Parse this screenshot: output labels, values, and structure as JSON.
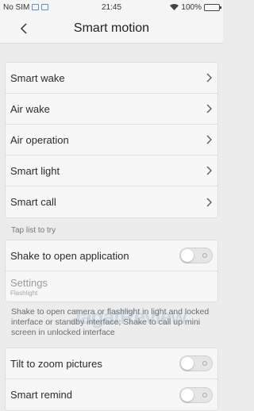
{
  "status": {
    "carrier": "No SIM",
    "time": "21:45",
    "battery": "100%",
    "battery_level": 1.0,
    "battery_color": "#3cb043"
  },
  "header": {
    "back_icon": "chevron-left-icon",
    "title": "Smart motion"
  },
  "main_menu": [
    {
      "label": "Smart wake"
    },
    {
      "label": "Air wake"
    },
    {
      "label": "Air operation"
    },
    {
      "label": "Smart light"
    },
    {
      "label": "Smart call"
    }
  ],
  "hint": "Tap list to try",
  "shake": {
    "label": "Shake to open application",
    "enabled": false,
    "settings_title": "Settings",
    "settings_sub": "Flashlight",
    "description": "Shake to open camera or flashlight in light and locked interface or standby interface; Shake to call up mini screen in unlocked interface"
  },
  "toggles": [
    {
      "label": "Tilt to zoom pictures",
      "enabled": false
    },
    {
      "label": "Smart remind",
      "enabled": false
    }
  ],
  "watermark": "JagatReview"
}
